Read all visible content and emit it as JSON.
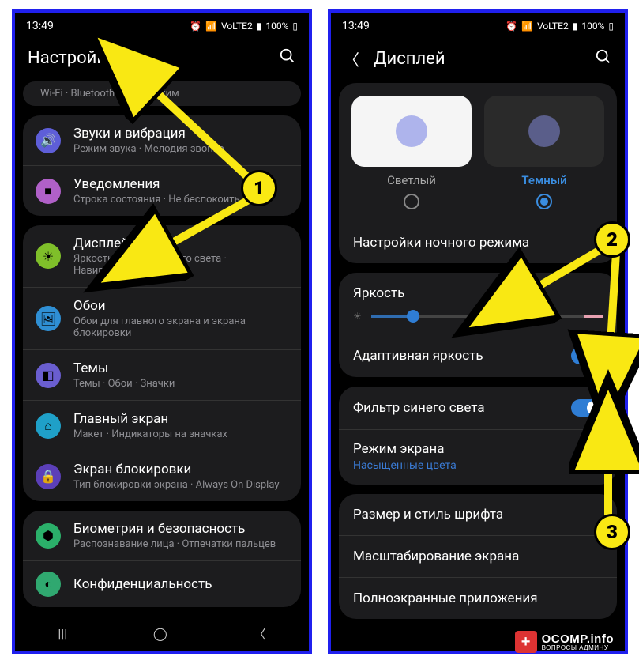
{
  "status": {
    "time": "13:49",
    "battery": "100%",
    "net": "VoLTE2"
  },
  "screen1": {
    "title": "Настройки",
    "truncated": "Wi-Fi  ·  Bluetooth  ·  Авиарежим",
    "groups": [
      [
        {
          "icon": "#5e5ed8",
          "glyph": "🔊",
          "title": "Звуки и вибрация",
          "sub": "Режим звука · Мелодия звонка"
        },
        {
          "icon": "#b060c8",
          "glyph": "■",
          "title": "Уведомления",
          "sub": "Строка состояния · Не беспокоить"
        }
      ],
      [
        {
          "icon": "#7fbf2a",
          "glyph": "☀",
          "title": "Дисплей",
          "sub": "Яркость · Фильтр синего света · Навигационная панель"
        },
        {
          "icon": "#2f8fd4",
          "glyph": "🖼",
          "title": "Обои",
          "sub": "Обои для главного экрана и экрана блокировки"
        },
        {
          "icon": "#6a5ed0",
          "glyph": "◧",
          "title": "Темы",
          "sub": "Темы · Обои · Значки"
        },
        {
          "icon": "#1fa0c8",
          "glyph": "⌂",
          "title": "Главный экран",
          "sub": "Макет · Индикаторы на значках"
        },
        {
          "icon": "#5b3fb8",
          "glyph": "🔒",
          "title": "Экран блокировки",
          "sub": "Тип блокировки экрана · Always On Display"
        }
      ],
      [
        {
          "icon": "#2bb06a",
          "glyph": "⬢",
          "title": "Биометрия и безопасность",
          "sub": "Распознавание лица · Отпечатки пальцев"
        },
        {
          "icon": "#30a870",
          "glyph": "◐",
          "title": "Конфиденциальность",
          "sub": ""
        }
      ]
    ]
  },
  "screen2": {
    "title": "Дисплей",
    "themes": {
      "light": "Светлый",
      "dark": "Темный"
    },
    "night_mode": "Настройки ночного режима",
    "brightness": "Яркость",
    "adaptive": "Адаптивная яркость",
    "bluelight": "Фильтр синего света",
    "screenmode": {
      "title": "Режим экрана",
      "value": "Насыщенные цвета"
    },
    "font": "Размер и стиль шрифта",
    "scale": "Масштабирование экрана",
    "fullscreen": "Полноэкранные приложения",
    "slider_pct": 18
  },
  "markers": {
    "m1": "1",
    "m2": "2",
    "m3": "3"
  },
  "watermark": {
    "line1": "OCOMP.info",
    "line2": "ВОПРОСЫ АДМИНУ"
  }
}
